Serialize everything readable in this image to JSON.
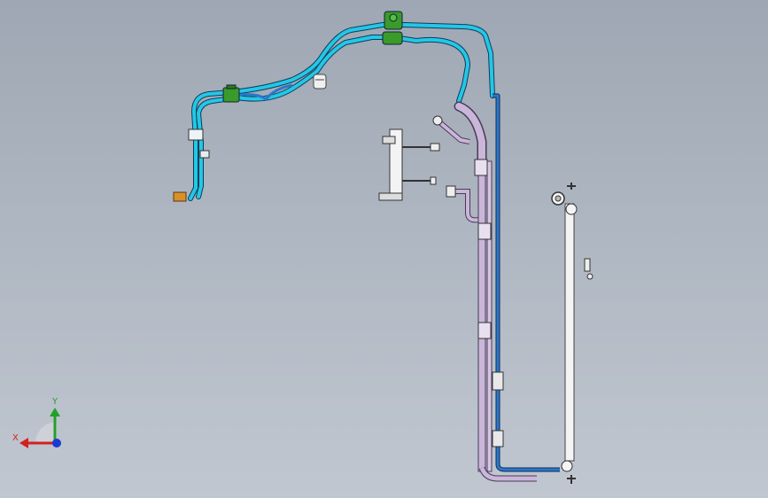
{
  "viewport": {
    "background_top": "#9ea7b3",
    "background_bottom": "#c0c7d1"
  },
  "colors": {
    "pipe_cyan": "#22c8e6",
    "pipe_blue": "#2b77c8",
    "pipe_lavender": "#c9b6d8",
    "pipe_white": "#f2f2f2",
    "clamp_green": "#3a9a2a",
    "fitting_orange": "#d8902a",
    "axis_x": "#d42020",
    "axis_y": "#22a02a",
    "axis_z": "#1a3ad0"
  },
  "triad": {
    "x_label": "X",
    "y_label": "Y"
  }
}
